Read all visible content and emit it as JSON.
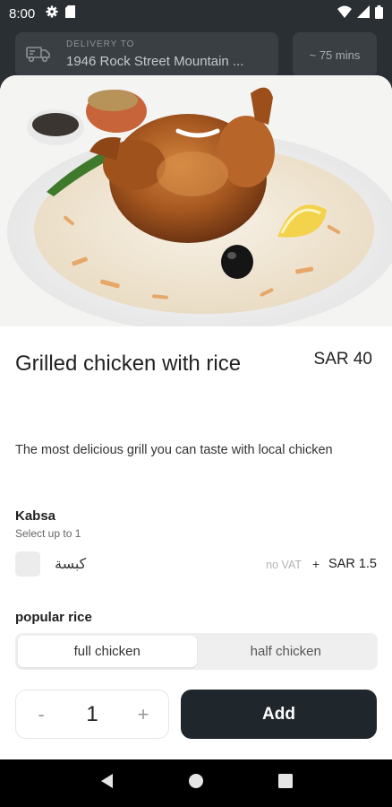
{
  "status_bar": {
    "time": "8:00",
    "icons": [
      "gear-icon",
      "sim-card-icon",
      "wifi-icon",
      "signal-icon",
      "battery-icon"
    ]
  },
  "header": {
    "delivery_label": "DELIVERY TO",
    "delivery_address": "1946 Rock Street Mountain ...",
    "eta": "~ 75 mins"
  },
  "product": {
    "image_alt": "Grilled chicken on rice with lemon and olive",
    "title": "Grilled chicken with rice",
    "price": "SAR 40",
    "description": "The most delicious grill you can taste with local chicken"
  },
  "groups": [
    {
      "title": "Kabsa",
      "subtitle": "Select up to 1",
      "options": [
        {
          "name": "كبسة",
          "vat_note": "no VAT",
          "plus": "+",
          "price": "SAR 1.5",
          "checked": false
        }
      ]
    },
    {
      "title": "popular rice",
      "segments": [
        "full chicken",
        "half chicken"
      ],
      "selected": 0
    }
  ],
  "cart": {
    "minus": "-",
    "quantity": "1",
    "plus": "+",
    "add_label": "Add"
  },
  "colors": {
    "header_bg": "#2a2f33",
    "add_button": "#1f272d",
    "sheet_bg": "#ffffff"
  }
}
